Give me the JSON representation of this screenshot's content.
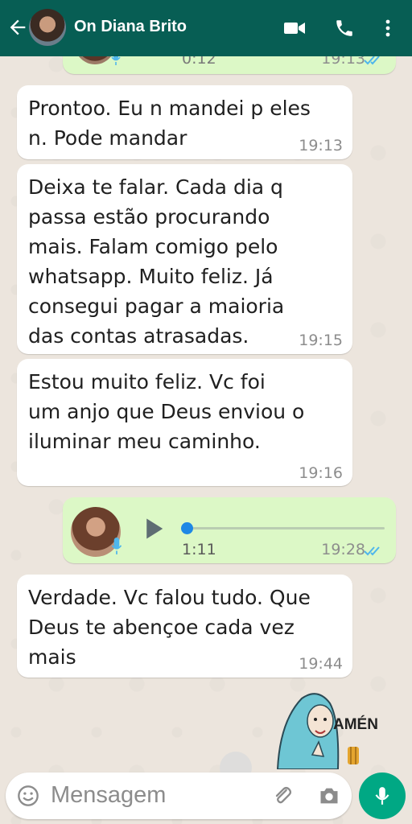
{
  "header": {
    "title": "On Diana Brito"
  },
  "messages": [
    {
      "type": "voice-out",
      "duration": "0:12",
      "time": "19:13",
      "status": "read"
    },
    {
      "type": "text-in",
      "text": "Prontoo. Eu n mandei p eles\nn. Pode mandar",
      "time": "19:13"
    },
    {
      "type": "text-in",
      "text": "Deixa te falar. Cada dia q\npassa estão procurando\nmais. Falam comigo pelo\nwhatsapp. Muito feliz. Já\nconsegui pagar a maioria\ndas contas atrasadas.",
      "time": "19:15"
    },
    {
      "type": "text-in",
      "text": "Estou muito feliz. Vc foi\num anjo que Deus enviou o\niluminar meu caminho.",
      "time": "19:16"
    },
    {
      "type": "voice-out",
      "duration": "1:11",
      "time": "19:28",
      "status": "read",
      "progress": 0.0
    },
    {
      "type": "text-in",
      "text": "Verdade. Vc falou tudo. Que\nDeus te abençoe cada vez\nmais",
      "time": "19:44"
    }
  ],
  "sticker": {
    "text": "AMÉN"
  },
  "composer": {
    "placeholder": "Mensagem"
  },
  "colors": {
    "header": "#075e54",
    "outgoing_bubble": "#dcf8c6",
    "incoming_bubble": "#ffffff",
    "accent": "#00a884",
    "read_ticks": "#4fb6ec"
  },
  "icons": [
    "back-arrow-icon",
    "video-call-icon",
    "phone-icon",
    "more-vert-icon",
    "play-icon",
    "mic-small-icon",
    "emoji-icon",
    "attach-icon",
    "camera-icon",
    "mic-icon",
    "read-ticks-icon"
  ]
}
